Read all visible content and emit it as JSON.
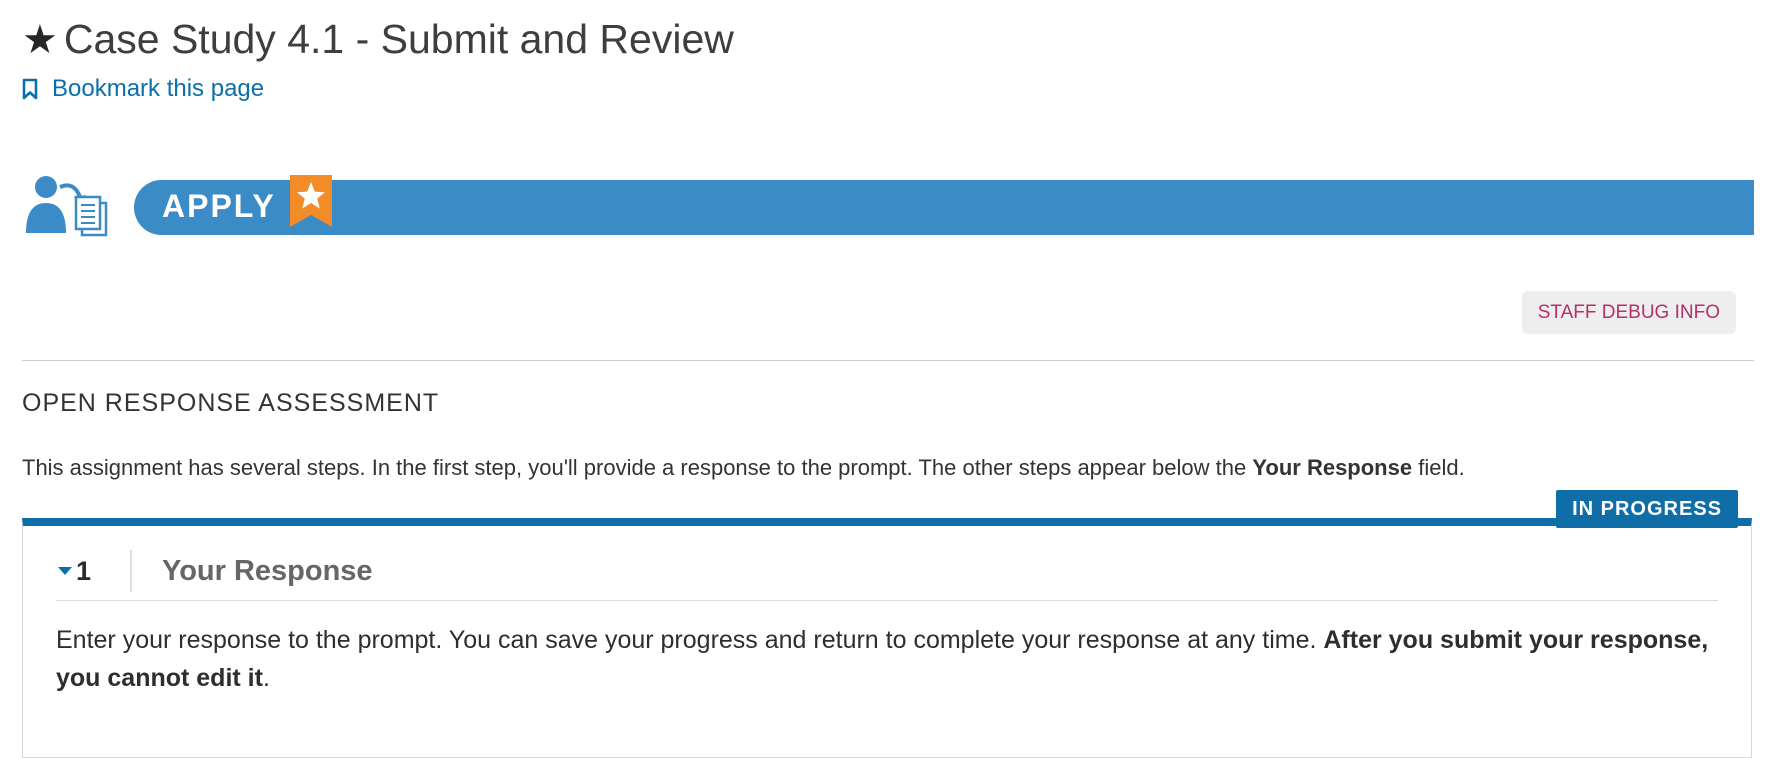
{
  "header": {
    "star": "★",
    "title": "Case Study 4.1 - Submit and Review",
    "bookmark_label": "Bookmark this page"
  },
  "banner": {
    "label": "APPLY",
    "color": "#3b8bc6",
    "badge_color": "#f28c28"
  },
  "debug_button": {
    "label": "STAFF DEBUG INFO"
  },
  "assessment": {
    "heading": "OPEN RESPONSE ASSESSMENT",
    "intro_text": "This assignment has several steps. In the first step, you'll provide a response to the prompt. The other steps appear below the ",
    "intro_bold": "Your Response",
    "intro_tail": " field.",
    "status": "IN PROGRESS",
    "step": {
      "number": "1",
      "title": "Your Response",
      "desc_text": "Enter your response to the prompt. You can save your progress and return to complete your response at any time. ",
      "desc_bold": "After you submit your response, you cannot edit it",
      "desc_tail": "."
    }
  },
  "colors": {
    "accent": "#0f6ea8",
    "link": "#0a6fab",
    "debug_text": "#b5306b"
  }
}
